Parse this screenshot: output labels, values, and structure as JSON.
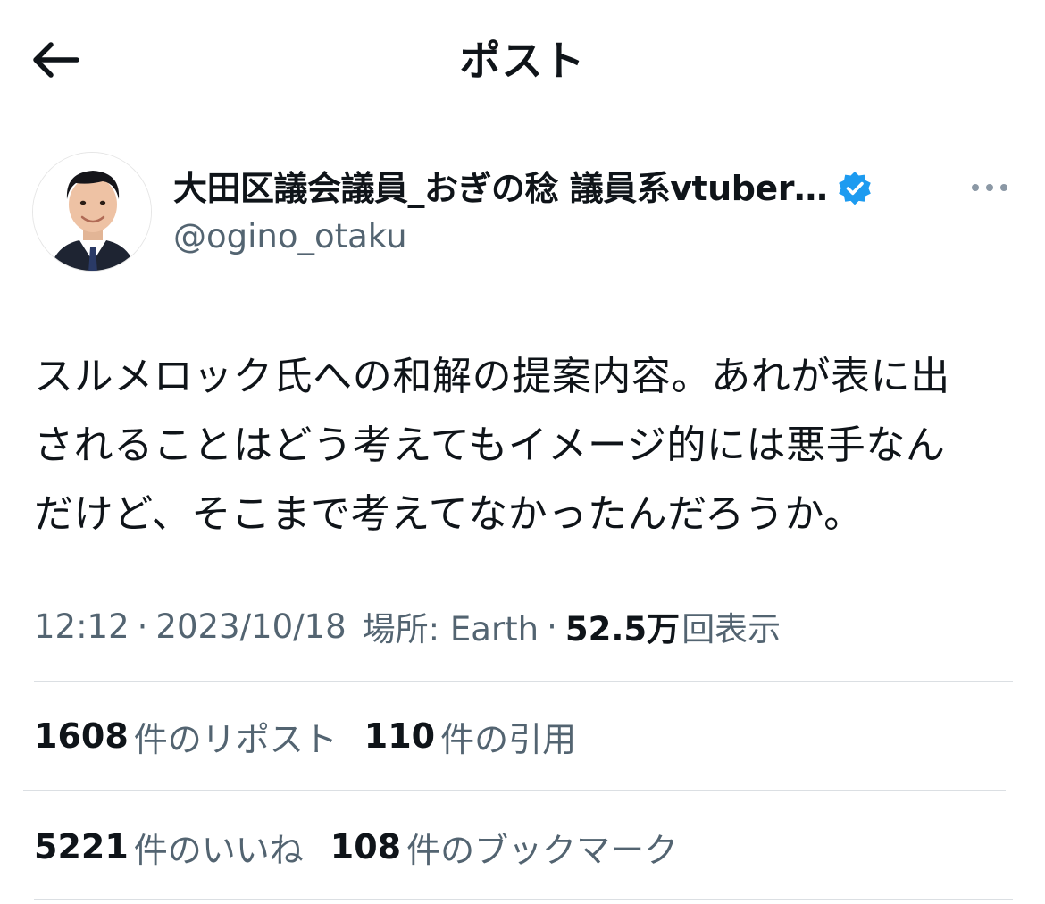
{
  "header": {
    "title": "ポスト",
    "back_icon": "arrow-left-icon"
  },
  "author": {
    "display_name": "大田区議会議員_おぎの稔 議員系vtuber…",
    "handle": "@ogino_otaku",
    "verified_icon": "verified-badge-icon",
    "more_icon": "more-horizontal-icon"
  },
  "post": {
    "text": "スルメロック氏への和解の提案内容。あれが表に出\nされることはどう考えてもイメージ的には悪手なん\nだけど、そこまで考えてなかったんだろうか。"
  },
  "meta": {
    "time": "12:12",
    "separator": "·",
    "date": "2023/10/18",
    "location": "場所: Earth",
    "views_count": "52.5万",
    "views_label": "回表示"
  },
  "stats": {
    "reposts": {
      "count": "1608",
      "label": "件のリポスト"
    },
    "quotes": {
      "count": "110",
      "label": "件の引用"
    },
    "likes": {
      "count": "5221",
      "label": "件のいいね"
    },
    "bookmarks": {
      "count": "108",
      "label": "件のブックマーク"
    }
  },
  "colors": {
    "text_primary": "#0f1419",
    "text_secondary": "#536471",
    "verified_blue": "#1d9bf0",
    "divider": "#dbdfe3"
  }
}
